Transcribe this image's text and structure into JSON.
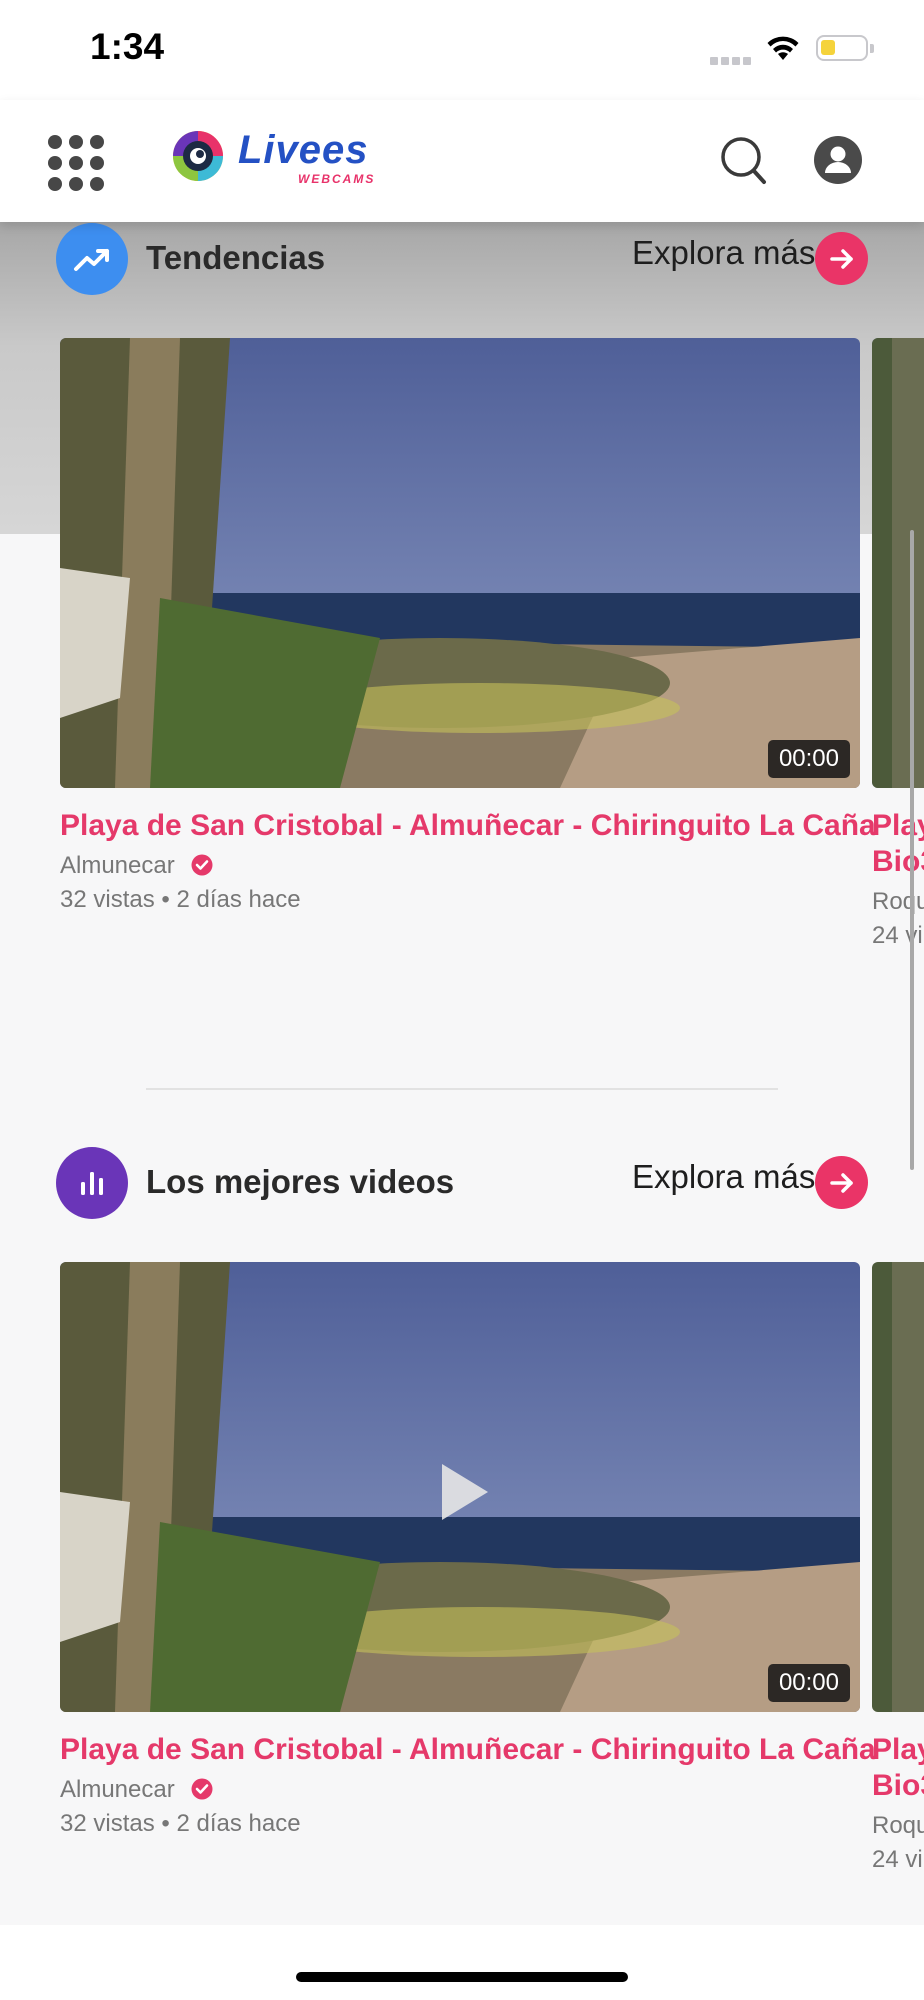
{
  "status_bar": {
    "time": "1:34"
  },
  "header": {
    "logo_text": "Livees",
    "logo_subtext": "WEBCAMS"
  },
  "sections": [
    {
      "title": "Tendencias",
      "icon": "trending-up-icon",
      "icon_color": "#3d8ef0",
      "explore_label": "Explora más",
      "card": {
        "title": "Playa de San Cristobal - Almuñecar - Chiringuito La Caña",
        "channel": "Almunecar",
        "meta": "32 vistas • 2 días hace",
        "duration": "00:00"
      },
      "peek": {
        "title_line1": "Play",
        "title_line2": "Bio3",
        "channel": "Roqu",
        "meta": "24 vi"
      }
    },
    {
      "title": "Los mejores videos",
      "icon": "bar-chart-icon",
      "icon_color": "#6a35b8",
      "explore_label": "Explora más",
      "card": {
        "title": "Playa de San Cristobal - Almuñecar - Chiringuito La Caña",
        "channel": "Almunecar",
        "meta": "32 vistas • 2 días hace",
        "duration": "00:00"
      },
      "peek": {
        "title_line1": "Play",
        "title_line2": "Bio3",
        "channel": "Roqu",
        "meta": "24 vi"
      }
    }
  ],
  "colors": {
    "accent": "#ea3467",
    "title_pink": "#e5396a",
    "brand_blue": "#2451c4"
  }
}
